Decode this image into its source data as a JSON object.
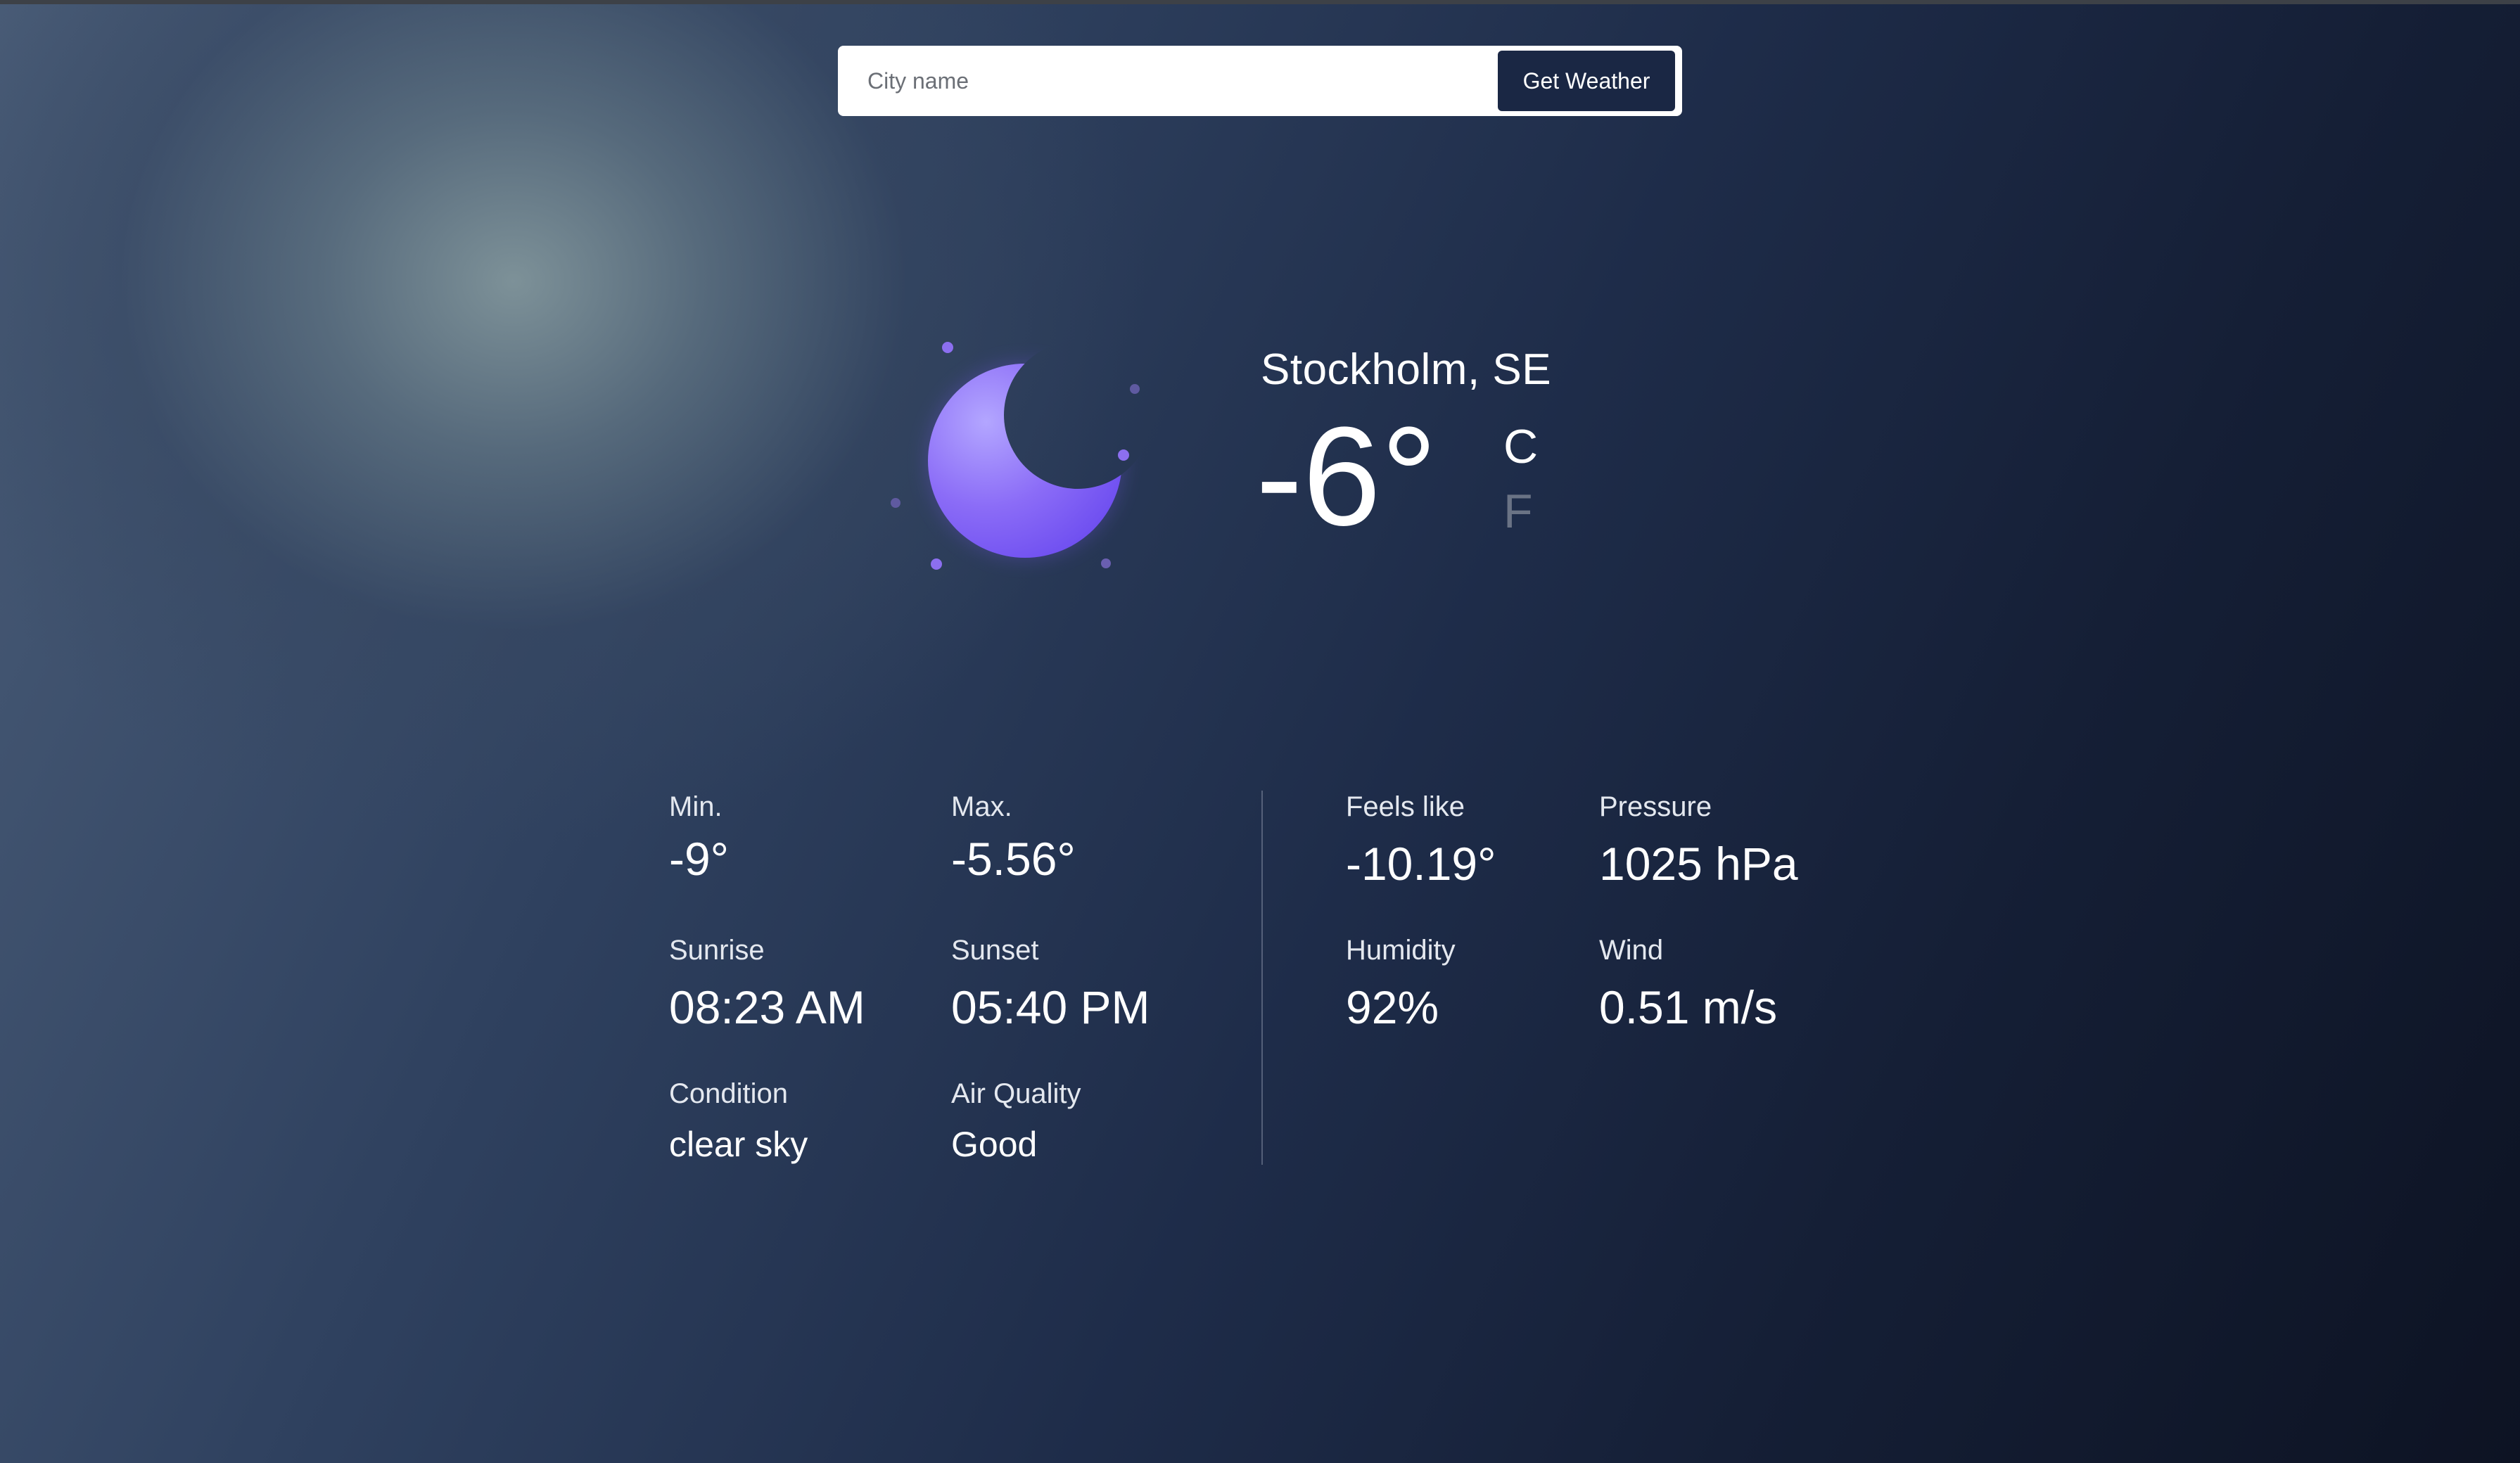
{
  "search": {
    "placeholder": "City name",
    "value": "",
    "button_label": "Get Weather"
  },
  "weather_icon": {
    "name": "moon-icon",
    "condition_symbol": "clear-night",
    "colors": {
      "moon_light": "#a694ff",
      "moon_dark": "#7b5af5",
      "sparkle": "#8c6ff0"
    }
  },
  "location": {
    "city": "Stockholm, SE"
  },
  "temperature": {
    "value": "-6°",
    "unit_c": "C",
    "unit_f": "F",
    "active_unit": "C"
  },
  "stats_left": [
    {
      "label": "Min.",
      "value": "-9°"
    },
    {
      "label": "Max.",
      "value": "-5.56°"
    },
    {
      "label": "Sunrise",
      "value": "08:23 AM"
    },
    {
      "label": "Sunset",
      "value": "05:40 PM"
    },
    {
      "label": "Condition",
      "value": "clear sky"
    },
    {
      "label": "Air Quality",
      "value": "Good"
    }
  ],
  "stats_right": [
    {
      "label": "Feels like",
      "value": "-10.19°"
    },
    {
      "label": "Pressure",
      "value": "1025 hPa"
    },
    {
      "label": "Humidity",
      "value": "92%"
    },
    {
      "label": "Wind",
      "value": "0.51 m/s"
    }
  ],
  "colors": {
    "button_bg": "#1a2744",
    "inactive_unit": "#6a7385",
    "accent": "#7b5af5"
  }
}
